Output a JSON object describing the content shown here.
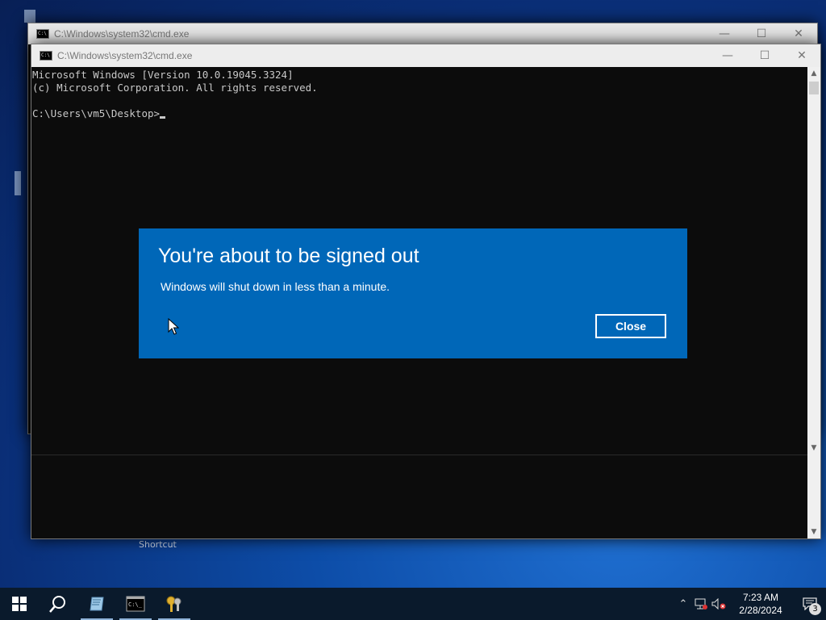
{
  "background_window": {
    "title": "C:\\Windows\\system32\\cmd.exe"
  },
  "cmd_window": {
    "title": "C:\\Windows\\system32\\cmd.exe",
    "lines": [
      "Microsoft Windows [Version 10.0.19045.3324]",
      "(c) Microsoft Corporation. All rights reserved.",
      "",
      "C:\\Users\\vm5\\Desktop>"
    ]
  },
  "desktop": {
    "shortcut_label": "Shortcut"
  },
  "dialog": {
    "title": "You're about to be signed out",
    "message": "Windows will shut down in less than a minute.",
    "close_label": "Close"
  },
  "taskbar": {
    "time": "7:23 AM",
    "date": "2/28/2024",
    "notification_count": "3"
  },
  "colors": {
    "dialog_bg": "#0067b8",
    "console_bg": "#0c0c0c",
    "taskbar_bg": "#0a1a2c"
  }
}
